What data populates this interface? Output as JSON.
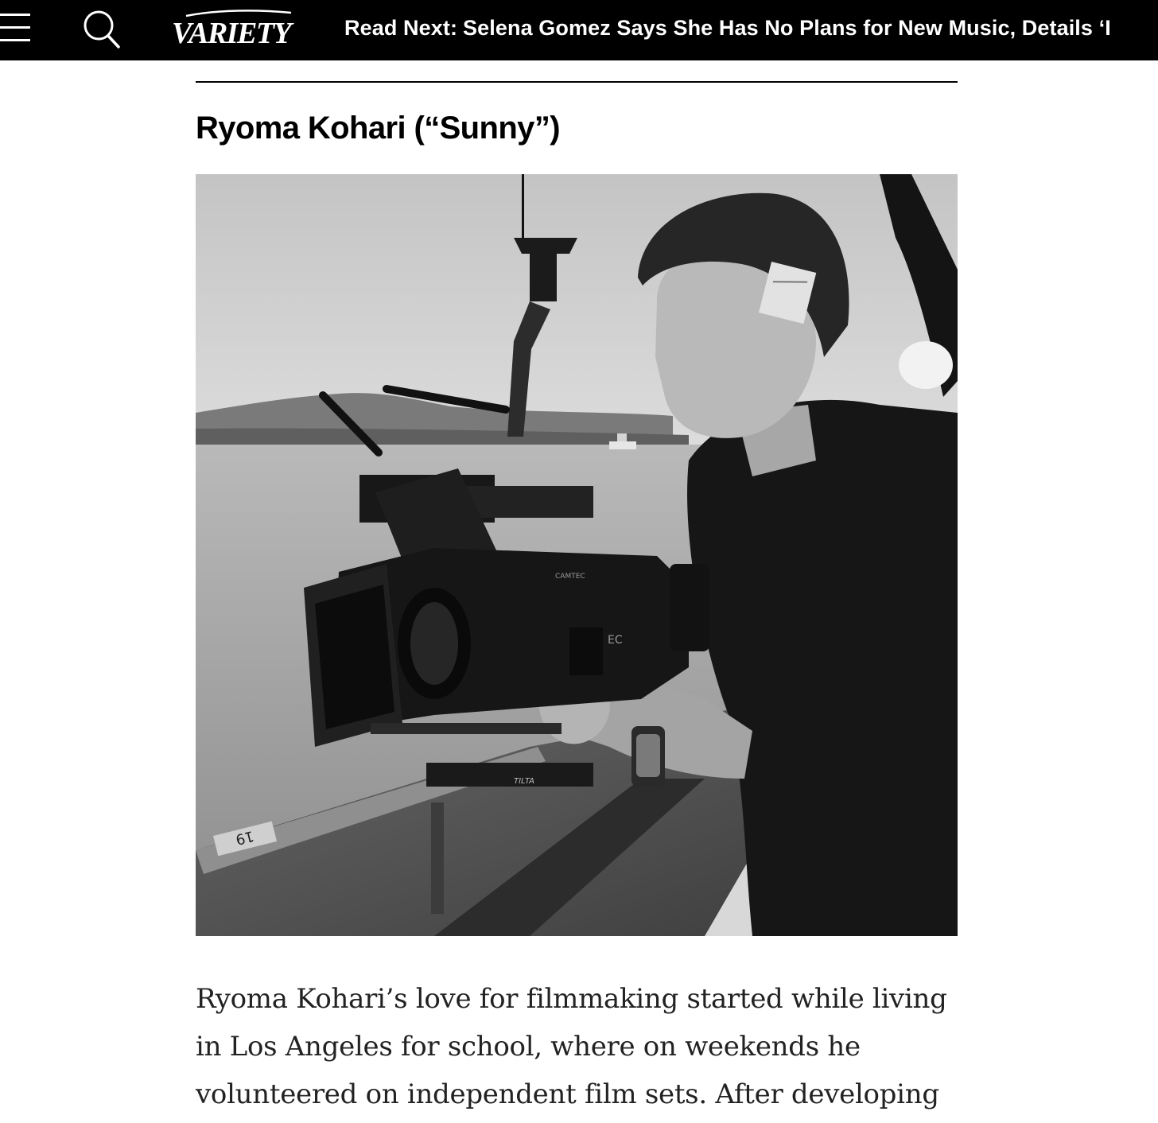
{
  "header": {
    "logo_text": "VARIETY",
    "read_next_label": "Read Next:",
    "read_next_headline": "Selena Gomez Says She Has No Plans for New Music, Details ‘I"
  },
  "article": {
    "section_heading": "Ryoma Kohari (“Sunny”)",
    "photo": {
      "description_icon": "photo-cameraman-on-boat",
      "camera_markings": [
        "CAMTEC",
        "EC",
        "TILTA"
      ],
      "marker_number": "19"
    },
    "share_icon": "share-icon",
    "body_paragraph": "Ryoma Kohari’s love for filmmaking started while living in Los Angeles for school, where on weekends he volunteered on independent film sets. After developing"
  },
  "colors": {
    "topbar_background": "#000000",
    "topbar_text": "#ffffff",
    "share_button": "#2c6fd1",
    "body_text": "#222222"
  }
}
